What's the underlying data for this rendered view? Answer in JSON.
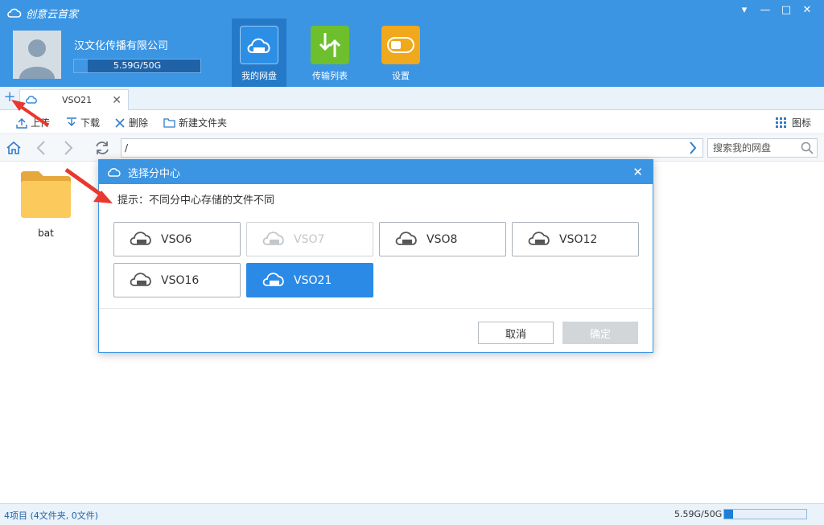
{
  "app": {
    "title": "创意云首家",
    "window_controls": [
      "▾",
      "—",
      "□",
      "✕"
    ]
  },
  "account": {
    "company": "汉文化传播有限公司",
    "quota_text": "5.59G/50G",
    "quota_fraction": 0.11
  },
  "nav": [
    {
      "label": "我的网盘",
      "icon": "cloud-drive-icon",
      "active": true,
      "color": "#2c8fe5"
    },
    {
      "label": "传输列表",
      "icon": "transfer-icon",
      "active": false,
      "color": "#6dbf2e"
    },
    {
      "label": "设置",
      "icon": "settings-toggle-icon",
      "active": false,
      "color": "#f0a81d"
    }
  ],
  "tabs": {
    "add_icon": "+",
    "items": [
      {
        "label": "VSO21",
        "close": "✕"
      }
    ]
  },
  "toolbar": {
    "upload": "上传",
    "download": "下载",
    "delete": "删除",
    "new_folder": "新建文件夹",
    "view": "图标"
  },
  "addressbar": {
    "path": "/",
    "search_placeholder": "搜索我的网盘"
  },
  "files": [
    {
      "name": "bat",
      "type": "folder"
    }
  ],
  "status": {
    "summary": "4项目 (4文件夹, 0文件)",
    "quota_text": "5.59G/50G",
    "quota_fraction": 0.11
  },
  "dialog": {
    "title": "选择分中心",
    "close": "✕",
    "hint": "提示：不同分中心存储的文件不同",
    "centers": [
      {
        "label": "VSO6",
        "state": "normal"
      },
      {
        "label": "VSO7",
        "state": "disabled"
      },
      {
        "label": "VSO8",
        "state": "normal"
      },
      {
        "label": "VSO12",
        "state": "normal"
      },
      {
        "label": "VSO16",
        "state": "normal"
      },
      {
        "label": "VSO21",
        "state": "selected"
      }
    ],
    "cancel": "取消",
    "confirm": "确定"
  },
  "colors": {
    "header": "#3b95e3",
    "accent": "#2b8ae6",
    "annotation_arrow": "#e8382f"
  }
}
